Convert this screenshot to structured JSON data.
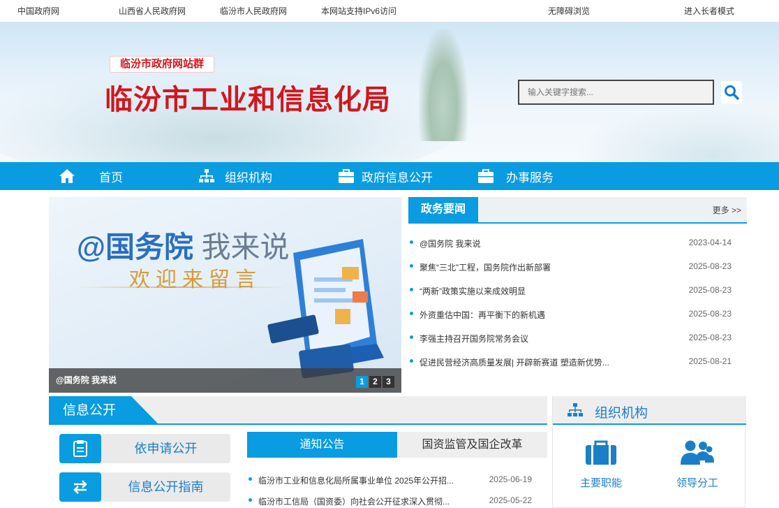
{
  "topbar": {
    "links": [
      "中国政府网",
      "山西省人民政府网",
      "临汾市人民政府网",
      "本网站支持IPv6访问"
    ],
    "accessibility": "无障碍浏览",
    "elder_mode": "进入长者模式"
  },
  "header": {
    "site_group": "临汾市政府网站群",
    "site_name": "临汾市工业和信息化局",
    "search_placeholder": "输入关键字搜索..."
  },
  "nav": {
    "items": [
      {
        "label": "首页",
        "icon": "home-icon"
      },
      {
        "label": "组织机构",
        "icon": "org-chart-icon"
      },
      {
        "label": "政府信息公开",
        "icon": "briefcase-icon"
      },
      {
        "label": "办事服务",
        "icon": "briefcase-icon"
      }
    ]
  },
  "slider": {
    "headline_main": "@国务院",
    "headline_light": "我来说",
    "subline": "欢迎来留言",
    "caption": "@国务院 我来说",
    "pages": [
      "1",
      "2",
      "3"
    ],
    "active_page": "1"
  },
  "news": {
    "tab": "政务要闻",
    "more": "更多",
    "items": [
      {
        "title": "@国务院 我来说",
        "date": "2023-04-14"
      },
      {
        "title": "聚焦“三北”工程，国务院作出新部署",
        "date": "2025-08-23"
      },
      {
        "title": "“两新”政策实施以来成效明显",
        "date": "2025-08-23"
      },
      {
        "title": "外资重估中国：再平衡下的新机遇",
        "date": "2025-08-23"
      },
      {
        "title": "李强主持召开国务院常务会议",
        "date": "2025-08-23"
      },
      {
        "title": "促进民营经济高质量发展| 开辟新赛道 塑造新优势...",
        "date": "2025-08-21"
      }
    ]
  },
  "info": {
    "title": "信息公开",
    "quick_links": [
      {
        "label": "依申请公开",
        "icon": "document-icon"
      },
      {
        "label": "信息公开指南",
        "icon": "swap-arrows-icon"
      }
    ],
    "tabs": [
      "通知公告",
      "国资监管及国企改革"
    ],
    "notices": [
      {
        "title": "临汾市工业和信息化局所属事业单位 2025年公开招...",
        "date": "2025-06-19"
      },
      {
        "title": "临汾市工信局（国资委）向社会公开征求深入贯彻...",
        "date": "2025-05-22"
      }
    ]
  },
  "org": {
    "title": "组织机构",
    "items": [
      {
        "label": "主要职能",
        "icon": "briefcase-icon"
      },
      {
        "label": "领导分工",
        "icon": "people-icon"
      }
    ]
  },
  "colors": {
    "accent": "#0a9ce0",
    "brand_red": "#d2161c"
  }
}
